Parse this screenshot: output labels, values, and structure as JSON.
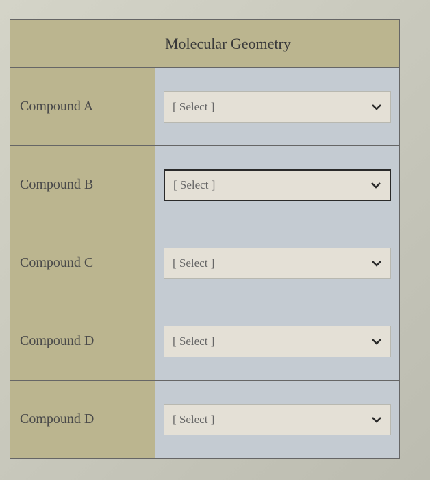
{
  "header": {
    "col1": "",
    "col2": "Molecular Geometry"
  },
  "rows": [
    {
      "label": "Compound A",
      "placeholder": "[ Select ]",
      "focused": false
    },
    {
      "label": "Compound B",
      "placeholder": "[ Select ]",
      "focused": true
    },
    {
      "label": "Compound C",
      "placeholder": "[ Select ]",
      "focused": false
    },
    {
      "label": "Compound D",
      "placeholder": "[ Select ]",
      "focused": false
    },
    {
      "label": "Compound D",
      "placeholder": "[ Select ]",
      "focused": false
    }
  ]
}
